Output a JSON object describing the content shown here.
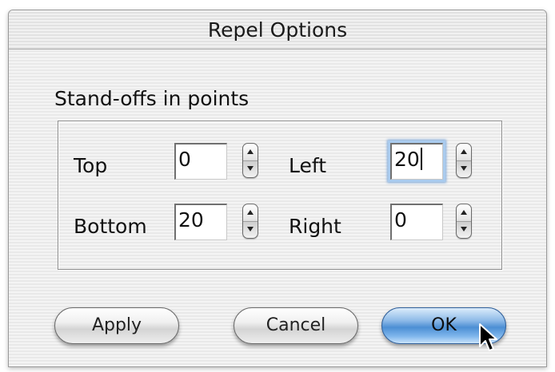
{
  "window": {
    "title": "Repel Options"
  },
  "section": {
    "label": "Stand-offs in points"
  },
  "fields": {
    "top": {
      "label": "Top",
      "value": "0"
    },
    "left": {
      "label": "Left",
      "value": "20"
    },
    "bottom": {
      "label": "Bottom",
      "value": "20"
    },
    "right": {
      "label": "Right",
      "value": "0"
    }
  },
  "buttons": {
    "apply": "Apply",
    "cancel": "Cancel",
    "ok": "OK"
  },
  "icons": {
    "stepper_up": "arrow-up-icon",
    "stepper_down": "arrow-down-icon",
    "cursor": "mouse-pointer-icon"
  },
  "colors": {
    "focus_ring": "#a9cbee",
    "default_button": "#4c8fd4"
  }
}
